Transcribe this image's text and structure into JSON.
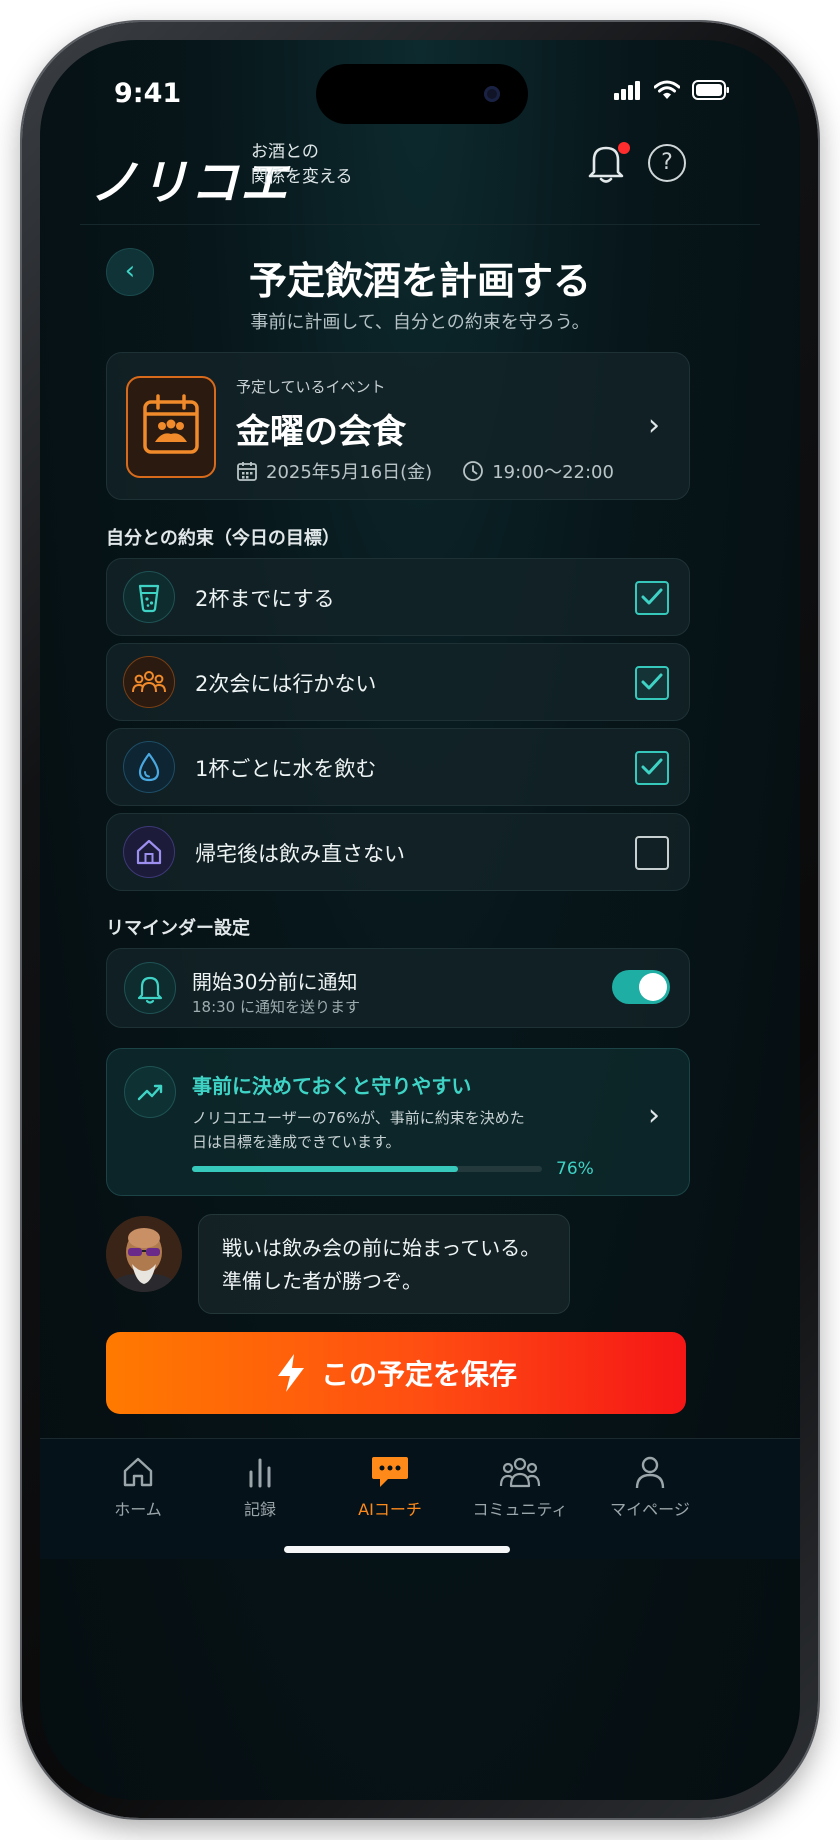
{
  "status_bar": {
    "time": "9:41"
  },
  "header": {
    "logo": "ノリコエ",
    "tagline_line1": "お酒との",
    "tagline_line2": "関係を変える"
  },
  "page": {
    "title": "予定飲酒を計画する",
    "subtitle": "事前に計画して、自分との約束を守ろう。"
  },
  "event": {
    "label": "予定しているイベント",
    "title": "金曜の会食",
    "date": "2025年5月16日(金)",
    "time": "19:00〜22:00"
  },
  "goals": {
    "section_label": "自分との約束（今日の目標）",
    "items": [
      {
        "label": "2杯までにする",
        "checked": true,
        "icon": "glass-icon",
        "color": "#2fb3a7"
      },
      {
        "label": "2次会には行かない",
        "checked": true,
        "icon": "group-icon",
        "color": "#e08426"
      },
      {
        "label": "1杯ごとに水を飲む",
        "checked": true,
        "icon": "water-drop-icon",
        "color": "#3a9fd8"
      },
      {
        "label": "帰宅後は飲み直さない",
        "checked": false,
        "icon": "house-icon",
        "color": "#7d6fd4"
      }
    ]
  },
  "reminder": {
    "section_label": "リマインダー設定",
    "title": "開始30分前に通知",
    "subtitle": "18:30 に通知を送ります",
    "enabled": true
  },
  "stat": {
    "title": "事前に決めておくと守りやすい",
    "body_line1": "ノリコエユーザーの76%が、事前に約束を決めた",
    "body_line2": "日は目標を達成できています。",
    "percent_label": "76%",
    "percent": 0.76
  },
  "coach": {
    "line1": "戦いは飲み会の前に始まっている。",
    "line2": "準備した者が勝つぞ。"
  },
  "save_button": {
    "label": "この予定を保存"
  },
  "tabs": [
    {
      "label": "ホーム",
      "icon": "home-icon",
      "active": false
    },
    {
      "label": "記録",
      "icon": "chart-bars-icon",
      "active": false
    },
    {
      "label": "AIコーチ",
      "icon": "chat-bubble-icon",
      "active": true
    },
    {
      "label": "コミュニティ",
      "icon": "community-icon",
      "active": false
    },
    {
      "label": "マイページ",
      "icon": "person-icon",
      "active": false
    }
  ],
  "colors": {
    "accent_teal": "#3fd3c6",
    "accent_orange": "#ff7a00",
    "notification_dot": "#ff2d2d"
  }
}
